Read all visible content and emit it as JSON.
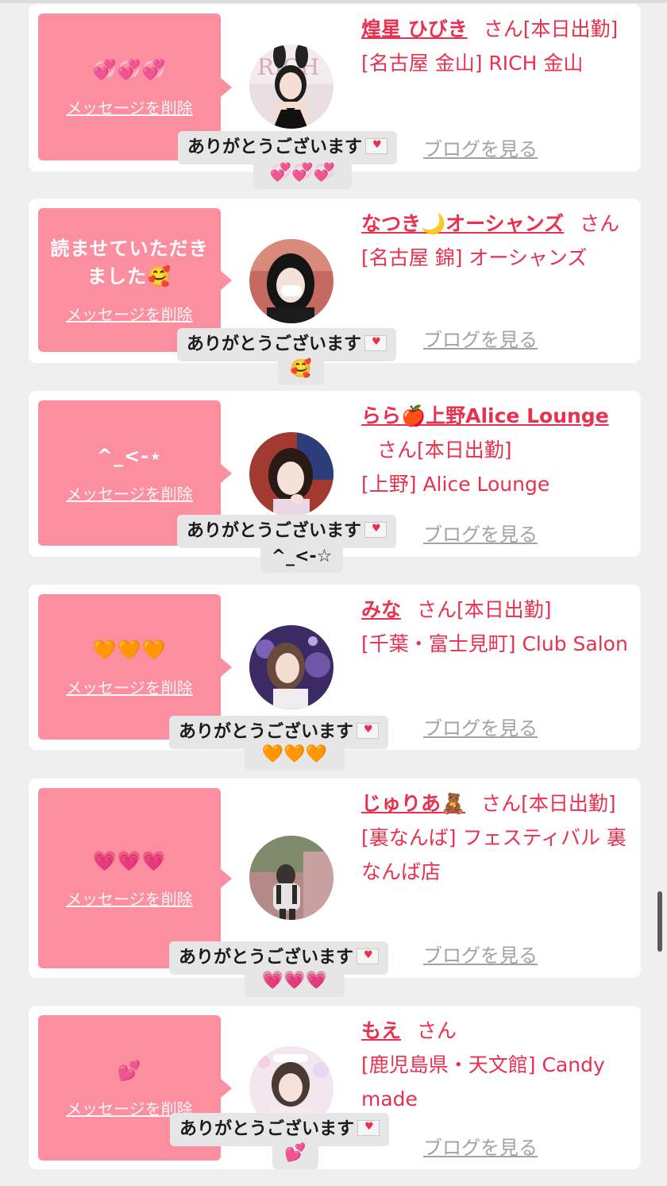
{
  "delete_label": "メッセージを削除",
  "thanks_label": "ありがとうございます",
  "san_label": "さん",
  "blog_label": "ブログを見る",
  "colors": {
    "accent": "#e8304f",
    "bubble": "#fb8e9f",
    "card": "#ffffff",
    "background": "#efefef"
  },
  "cards": [
    {
      "message": "💞💞💞",
      "name": "煌星 ひびき",
      "status": "[本日出勤]",
      "shop": "[名古屋 金山] RICH 金山",
      "echo": "💞💞💞",
      "avatar": "photo-bunny-girl"
    },
    {
      "message": "読ませていただきました🥰",
      "name": "なつき🌙オーシャンズ",
      "status": "",
      "shop": "[名古屋 錦] オーシャンズ",
      "echo": "🥰",
      "avatar": "photo-girl-dark-hair"
    },
    {
      "message": "^_<-⋆",
      "name": "らら🍎上野Alice Lounge",
      "status": "[本日出勤]",
      "shop": "[上野] Alice Lounge",
      "echo": "^_<-☆",
      "avatar": "photo-girl-bangs"
    },
    {
      "message": "🧡🧡🧡",
      "name": "みな",
      "status": "[本日出勤]",
      "shop": "[千葉・富士見町] Club Salon",
      "echo": "🧡🧡🧡",
      "avatar": "photo-girl-purple-room"
    },
    {
      "message": "💗💗💗",
      "name": "じゅりあ🧸",
      "status": "[本日出勤]",
      "shop": "[裏なんば] フェスティバル 裏なんば店",
      "echo": "💗💗💗",
      "avatar": "photo-girl-outdoor"
    },
    {
      "message": "💕",
      "name": "もえ",
      "status": "",
      "shop": "[鹿児島県・天文館] Candy made",
      "echo": "💕",
      "avatar": "photo-girl-pastel"
    }
  ]
}
